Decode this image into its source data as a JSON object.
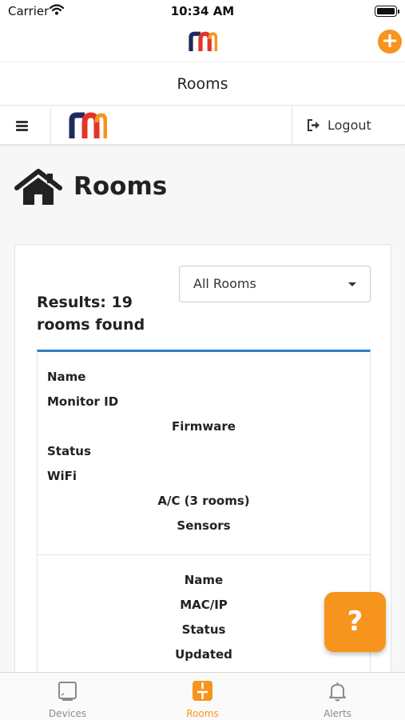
{
  "status_bar": {
    "carrier": "Carrier",
    "time": "10:34 AM"
  },
  "header": {
    "logo_icon": "rm-logo",
    "add_icon": "plus-icon",
    "add_symbol": "+"
  },
  "title_bar": {
    "title": "Rooms"
  },
  "nav": {
    "menu_icon": "hamburger-icon",
    "logout_label": "Logout",
    "logout_icon": "sign-out-icon"
  },
  "page": {
    "icon": "home-icon",
    "title": "Rooms"
  },
  "filter": {
    "selected": "All Rooms"
  },
  "results": {
    "text": "Results: 19 rooms found"
  },
  "room_table_headers": [
    "Name",
    "Monitor ID",
    "Firmware",
    "Status",
    "WiFi",
    "A/C (3 rooms)",
    "Sensors"
  ],
  "device_table_headers": [
    "Name",
    "MAC/IP",
    "Status",
    "Updated"
  ],
  "help": {
    "label": "?"
  },
  "tabs": [
    {
      "label": "Devices",
      "icon": "device-icon",
      "active": false
    },
    {
      "label": "Rooms",
      "icon": "room-icon",
      "active": true
    },
    {
      "label": "Alerts",
      "icon": "bell-icon",
      "active": false
    }
  ],
  "colors": {
    "accent": "#f7941d",
    "divider_blue": "#2d7fc1",
    "logo_navy": "#1f2b5b",
    "logo_red": "#e3342a"
  }
}
